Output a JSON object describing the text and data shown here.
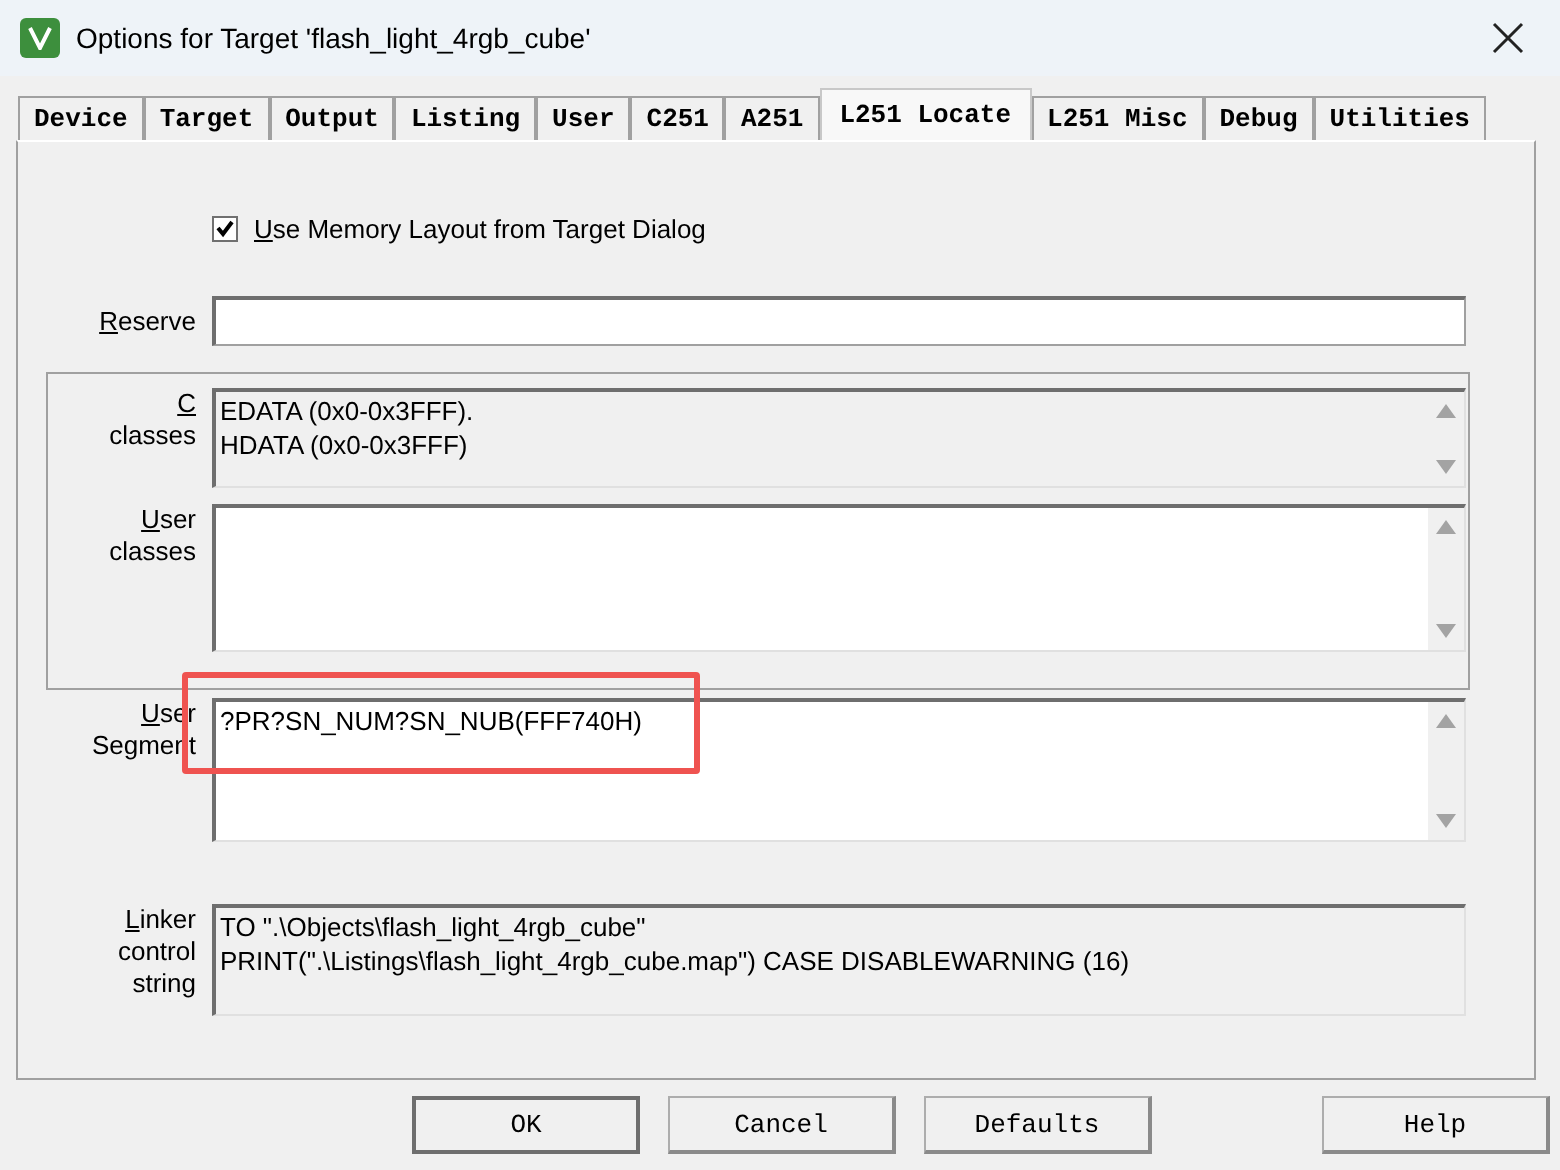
{
  "window": {
    "title": "Options for Target 'flash_light_4rgb_cube'"
  },
  "tabs": [
    {
      "label": "Device",
      "selected": false
    },
    {
      "label": "Target",
      "selected": false
    },
    {
      "label": "Output",
      "selected": false
    },
    {
      "label": "Listing",
      "selected": false
    },
    {
      "label": "User",
      "selected": false
    },
    {
      "label": "C251",
      "selected": false
    },
    {
      "label": "A251",
      "selected": false
    },
    {
      "label": "L251 Locate",
      "selected": true
    },
    {
      "label": "L251 Misc",
      "selected": false
    },
    {
      "label": "Debug",
      "selected": false
    },
    {
      "label": "Utilities",
      "selected": false
    }
  ],
  "memory_layout_option": {
    "label": "Use Memory Layout from Target Dialog",
    "checked": true
  },
  "reserve": {
    "label": "Reserve"
  },
  "classes_group": [
    {
      "label": [
        "C",
        "classes"
      ],
      "lines": [
        "EDATA (0x0-0x3FFF).",
        "HDATA (0x0-0x3FFF)"
      ],
      "readonly": true,
      "scrollbar": true
    },
    {
      "label": [
        "User",
        "classes"
      ],
      "readonly": false,
      "scrollbar": true
    }
  ],
  "user_segment": {
    "label": [
      "User",
      "Segment"
    ],
    "lines": [
      "?PR?SN_NUM?SN_NUB(FFF740H)"
    ],
    "readonly": false,
    "scrollbar": true,
    "highlighted": true
  },
  "linker_control": {
    "label": [
      "Linker",
      "control",
      "string"
    ],
    "lines": [
      "TO \".\\Objects\\flash_light_4rgb_cube\"",
      "PRINT(\".\\Listings\\flash_light_4rgb_cube.map\") CASE DISABLEWARNING (16)"
    ],
    "readonly": true,
    "scrollbar": false
  },
  "buttons": [
    {
      "label": "OK",
      "kind": "default"
    },
    {
      "label": "Cancel",
      "kind": "normal"
    },
    {
      "label": "Defaults",
      "kind": "normal"
    },
    {
      "label": "Help",
      "kind": "help"
    }
  ]
}
